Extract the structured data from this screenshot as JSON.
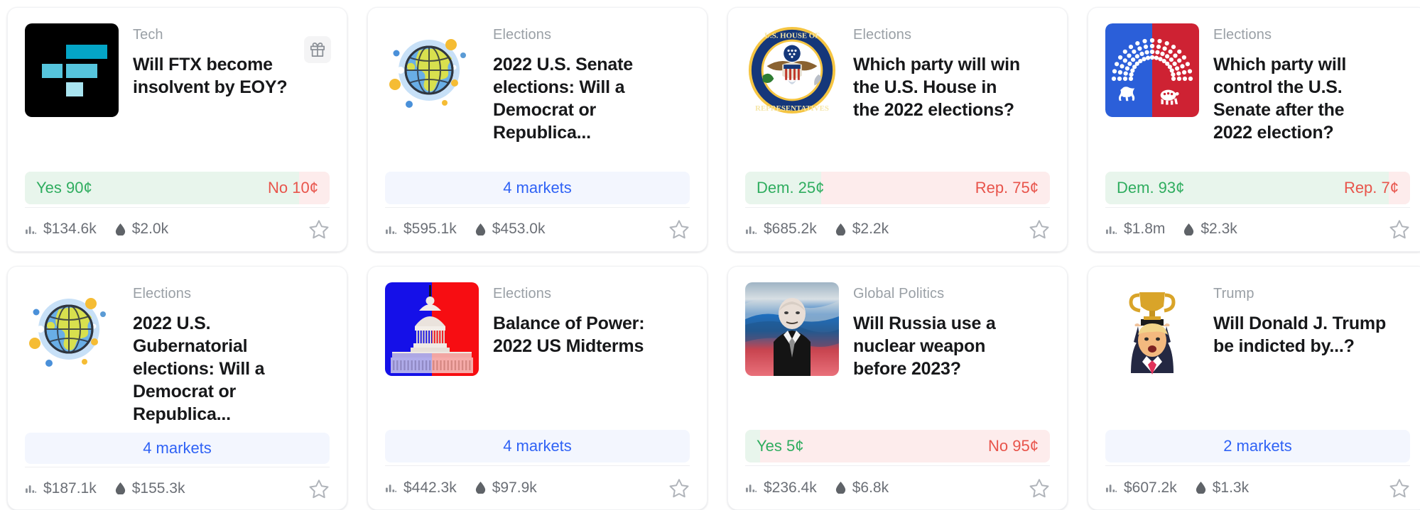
{
  "page": {
    "title": "Prediction markets grid"
  },
  "icons": {
    "gift": "gift-icon",
    "volume": "bar-chart-icon",
    "liquidity": "droplet-icon",
    "star": "star-outline-icon"
  },
  "colors": {
    "yes": "#2fad5f",
    "no": "#e8544b",
    "yes_bg": "#e8f5ec",
    "no_bg": "#fdecec",
    "markets_text": "#2f62f5",
    "markets_bg": "#f3f6fe",
    "category": "#9aa0a6",
    "title": "#17181a",
    "stats": "#6b6f76"
  },
  "cards": [
    {
      "id": "ftx-insolvent",
      "category": "Tech",
      "title": "Will FTX become insolvent by EOY?",
      "icon": "ftx-logo-icon",
      "has_gift": true,
      "type": "binary",
      "outcomes": {
        "yes_label": "Yes",
        "yes_price": "90¢",
        "yes_pct": 90,
        "no_label": "No",
        "no_price": "10¢",
        "no_pct": 10
      },
      "volume": "$134.6k",
      "liquidity": "$2.0k"
    },
    {
      "id": "senate-elections-2022",
      "category": "Elections",
      "title": "2022 U.S. Senate elections: Will a Democrat or Republica...",
      "icon": "globe-icon",
      "has_gift": false,
      "type": "grouped",
      "markets_label": "4 markets",
      "volume": "$595.1k",
      "liquidity": "$453.0k"
    },
    {
      "id": "house-2022",
      "category": "Elections",
      "title": "Which party will win the U.S. House in the 2022 elections?",
      "icon": "us-house-seal-icon",
      "has_gift": false,
      "type": "binary",
      "outcomes": {
        "yes_label": "Dem.",
        "yes_price": "25¢",
        "yes_pct": 25,
        "no_label": "Rep.",
        "no_price": "75¢",
        "no_pct": 75
      },
      "volume": "$685.2k",
      "liquidity": "$2.2k"
    },
    {
      "id": "senate-control-2022",
      "category": "Elections",
      "title": "Which party will control the U.S. Senate after the 2022 election?",
      "icon": "senate-party-split-icon",
      "has_gift": false,
      "type": "binary",
      "outcomes": {
        "yes_label": "Dem.",
        "yes_price": "93¢",
        "yes_pct": 93,
        "no_label": "Rep.",
        "no_price": "7¢",
        "no_pct": 7
      },
      "volume": "$1.8m",
      "liquidity": "$2.3k"
    },
    {
      "id": "gubernatorial-2022",
      "category": "Elections",
      "title": "2022 U.S. Gubernatorial elections: Will a Democrat or Republica...",
      "icon": "globe-icon",
      "has_gift": false,
      "type": "grouped",
      "markets_label": "4 markets",
      "volume": "$187.1k",
      "liquidity": "$155.3k"
    },
    {
      "id": "balance-of-power-2022",
      "category": "Elections",
      "title": "Balance of Power: 2022 US Midterms",
      "icon": "us-capitol-icon",
      "has_gift": false,
      "type": "grouped",
      "markets_label": "4 markets",
      "volume": "$442.3k",
      "liquidity": "$97.9k"
    },
    {
      "id": "russia-nuclear-2023",
      "category": "Global Politics",
      "title": "Will Russia use a nuclear weapon before 2023?",
      "icon": "putin-photo-icon",
      "has_gift": false,
      "type": "binary",
      "outcomes": {
        "yes_label": "Yes",
        "yes_price": "5¢",
        "yes_pct": 5,
        "no_label": "No",
        "no_price": "95¢",
        "no_pct": 95
      },
      "volume": "$236.4k",
      "liquidity": "$6.8k"
    },
    {
      "id": "trump-indicted",
      "category": "Trump",
      "title": "Will Donald J. Trump be indicted by...?",
      "icon": "trump-trophy-icon",
      "has_gift": false,
      "type": "grouped",
      "markets_label": "2 markets",
      "volume": "$607.2k",
      "liquidity": "$1.3k"
    }
  ]
}
